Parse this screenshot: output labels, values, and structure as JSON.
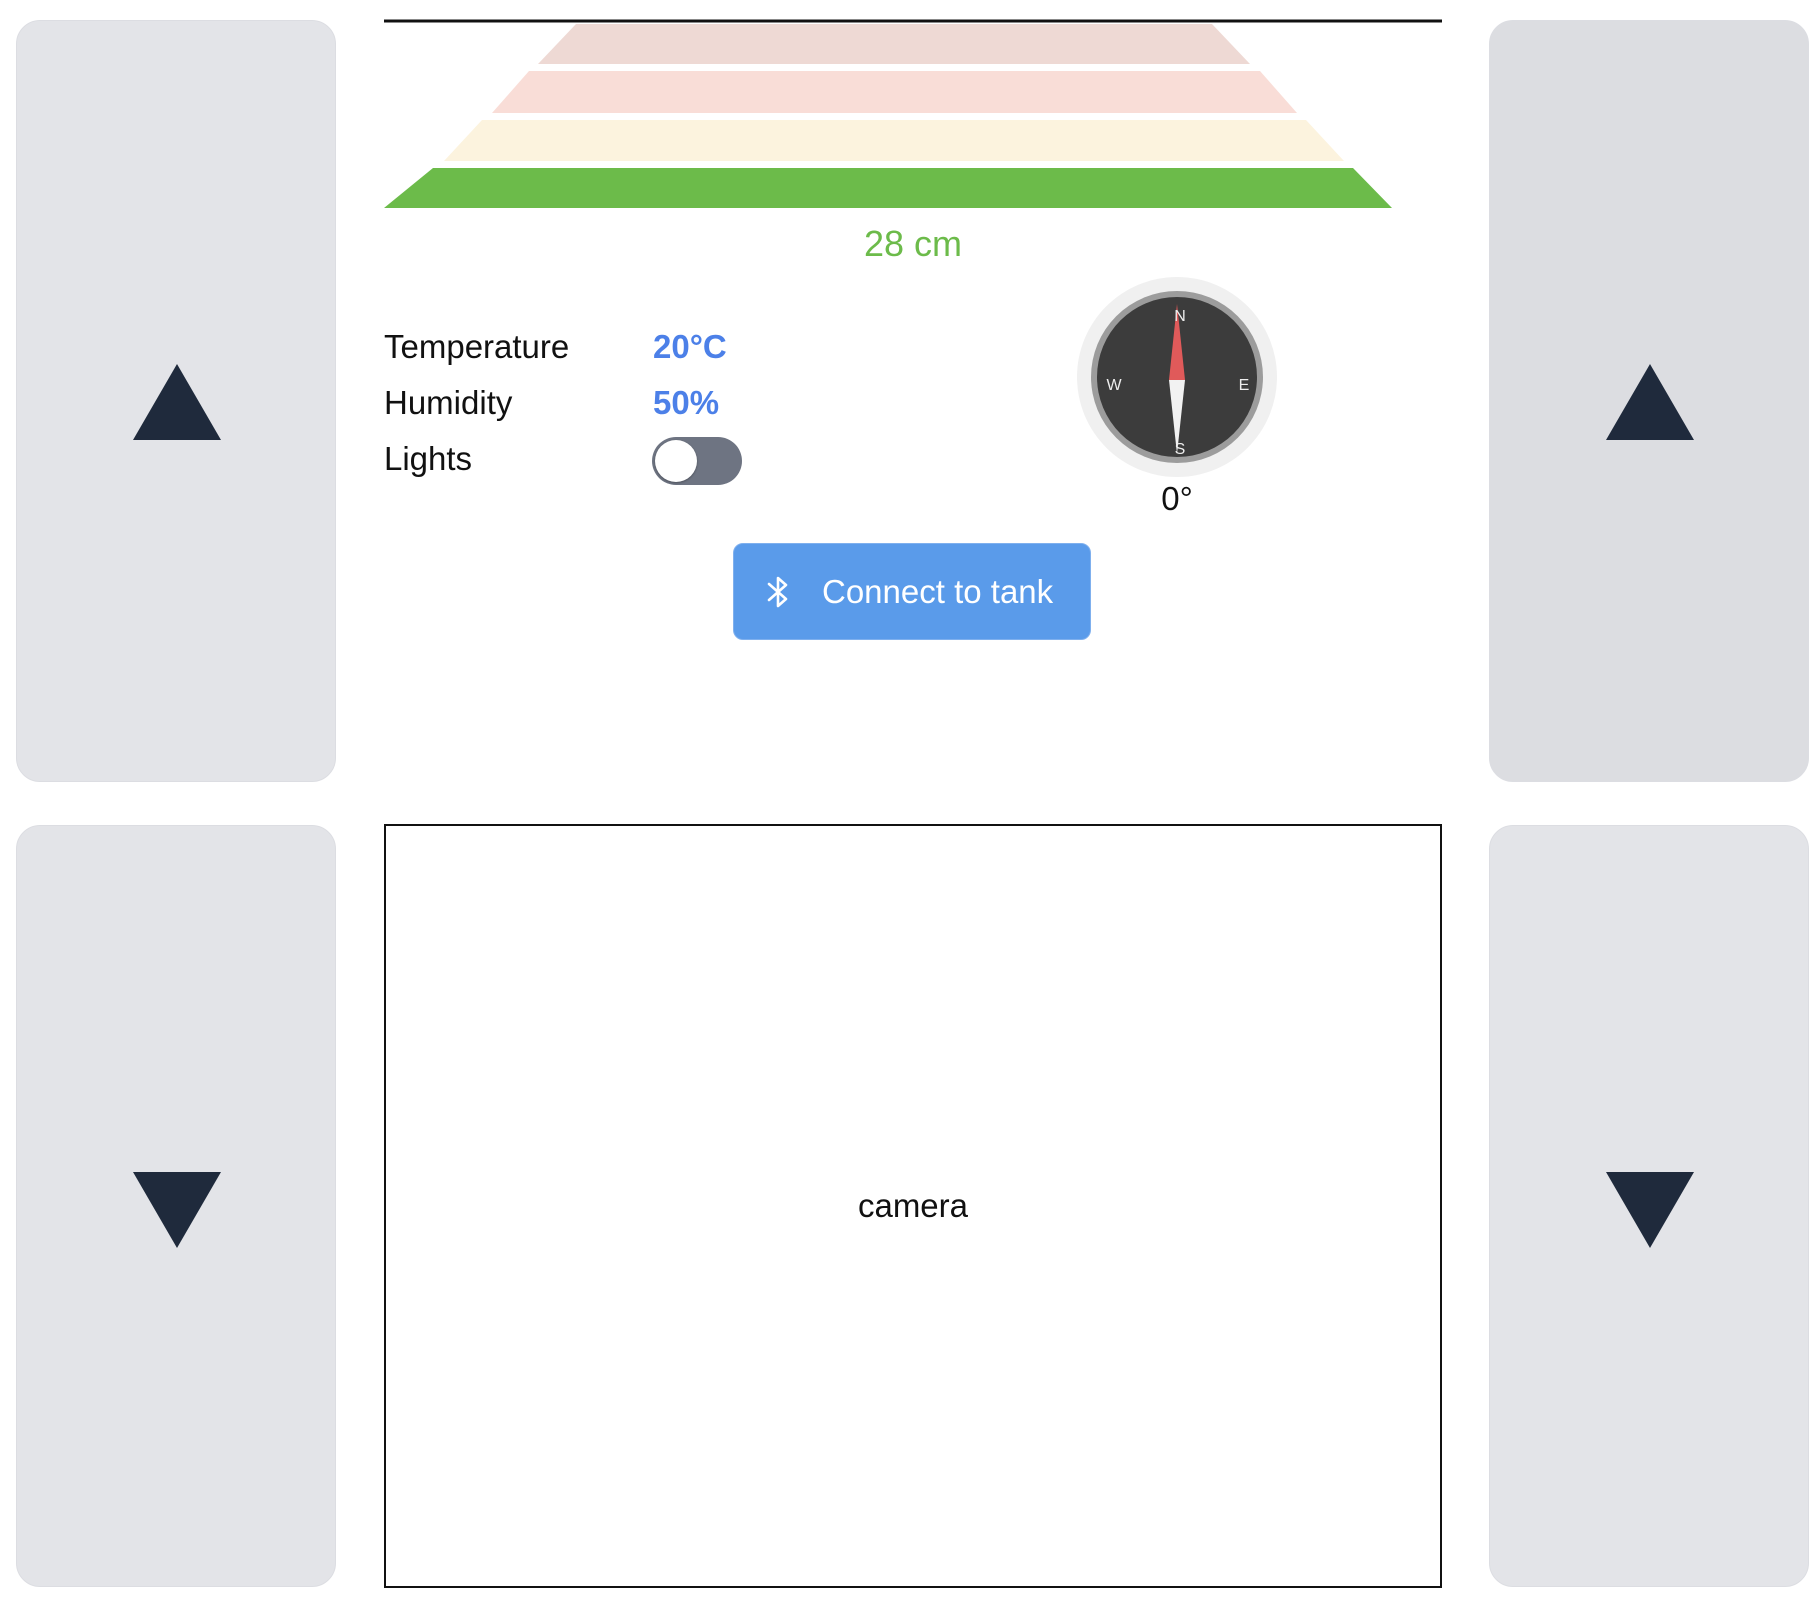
{
  "distance": {
    "readout": "28 cm",
    "value_cm": 28,
    "active_level": 1,
    "levels": [
      {
        "color": "#eed9d4"
      },
      {
        "color": "#f9ddd7"
      },
      {
        "color": "#fcf3de"
      },
      {
        "color": "#6cbb4a"
      }
    ]
  },
  "stats": {
    "temperature": {
      "label": "Temperature",
      "value": "20°C"
    },
    "humidity": {
      "label": "Humidity",
      "value": "50%"
    },
    "lights": {
      "label": "Lights",
      "on": false
    }
  },
  "compass": {
    "readout": "0°",
    "heading_deg": 0,
    "north": "N",
    "east": "E",
    "south": "S",
    "west": "W"
  },
  "connect_button": {
    "label": "Connect to tank",
    "icon": "bluetooth-icon"
  },
  "camera": {
    "label": "camera"
  },
  "controls": {
    "left_forward_icon": "triangle-up-icon",
    "right_forward_icon": "triangle-up-icon",
    "left_backward_icon": "triangle-down-icon",
    "right_backward_icon": "triangle-down-icon"
  },
  "colors": {
    "pad_background": "#e3e4e8",
    "arrow": "#1f2a3c",
    "accent_blue": "#4c80e8",
    "button_blue": "#5a9bea",
    "distance_green": "#6cbb4a",
    "toggle_off": "#6e7482",
    "compass_needle_north": "#e05a5a"
  }
}
